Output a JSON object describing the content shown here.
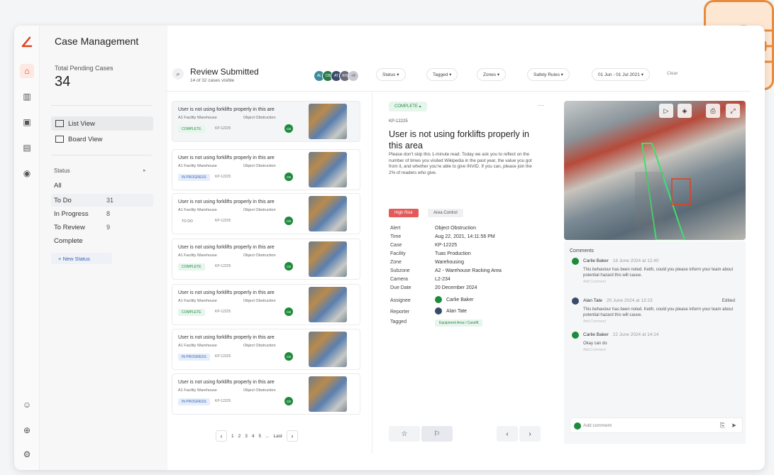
{
  "app": {
    "title": "Case Management"
  },
  "summary": {
    "label": "Total Pending Cases",
    "value": "34"
  },
  "views": [
    {
      "label": "List View"
    },
    {
      "label": "Board View"
    }
  ],
  "status": {
    "header": "Status",
    "items": [
      {
        "label": "All",
        "count": ""
      },
      {
        "label": "To Do",
        "count": "31"
      },
      {
        "label": "In Progress",
        "count": "8"
      },
      {
        "label": "To Review",
        "count": "9"
      },
      {
        "label": "Complete",
        "count": ""
      }
    ],
    "new_label": "+ New Status"
  },
  "review": {
    "title": "Review Submitted",
    "subtitle": "14 of 32 cases visible"
  },
  "filters": [
    {
      "label": "Status"
    },
    {
      "label": "Tagged"
    },
    {
      "label": "Zones"
    },
    {
      "label": "Safety Rules"
    },
    {
      "label": "01 Jun - 01 Jul 2021"
    }
  ],
  "clear_label": "Clear",
  "cases": [
    {
      "title": "User is not using forklifts properly in this are",
      "facility": "A1 Facility Warehouse",
      "type": "Object Obstruction",
      "status": "COMPLETE",
      "status_color": "#e6f6ec",
      "status_text_color": "#2a8a4a",
      "id": "KP-12225"
    },
    {
      "title": "User is not using forklifts properly in this are",
      "facility": "A1 Facility Warehouse",
      "type": "Object Obstruction",
      "status": "IN PROGRESS",
      "status_color": "#e6eefb",
      "status_text_color": "#3a64b8",
      "id": "KP-12225"
    },
    {
      "title": "User is not using forklifts properly in this are",
      "facility": "A1 Facility Warehouse",
      "type": "Object Obstruction",
      "status": "TO DO",
      "status_color": "#ffffff",
      "status_text_color": "#666666",
      "id": "KP-12225"
    },
    {
      "title": "User is not using forklifts properly in this are",
      "facility": "A1 Facility Warehouse",
      "type": "Object Obstruction",
      "status": "COMPLETE",
      "status_color": "#e6f6ec",
      "status_text_color": "#2a8a4a",
      "id": "KP-12225"
    },
    {
      "title": "User is not using forklifts properly in this are",
      "facility": "A1 Facility Warehouse",
      "type": "Object Obstruction",
      "status": "COMPLETE",
      "status_color": "#e6f6ec",
      "status_text_color": "#2a8a4a",
      "id": "KP-12225"
    },
    {
      "title": "User is not using forklifts properly in this are",
      "facility": "A1 Facility Warehouse",
      "type": "Object Obstruction",
      "status": "IN PROGRESS",
      "status_color": "#e6eefb",
      "status_text_color": "#3a64b8",
      "id": "KP-12225"
    },
    {
      "title": "User is not using forklifts properly in this are",
      "facility": "A1 Facility Warehouse",
      "type": "Object Obstruction",
      "status": "IN PROGRESS",
      "status_color": "#e6eefb",
      "status_text_color": "#3a64b8",
      "id": "KP-12225"
    }
  ],
  "pager": {
    "pages": [
      "1",
      "2",
      "3",
      "4",
      "5",
      "...",
      "Last"
    ]
  },
  "detail": {
    "status": "COMPLETE",
    "id": "KP-12225",
    "title": "User is not using forklifts properly in this area",
    "description": "Please don't skip this 1-minute read. Today we ask you to reflect on the number of times you visited Wikipedia in the past year, the value you got from it, and whether you're able to give INVID. If you can, please join the 2% of readers who give.",
    "tags": [
      "High Risk",
      "Area Control"
    ],
    "fields": [
      {
        "label": "Alert",
        "value": "Object Obstruction"
      },
      {
        "label": "Time",
        "value": "Aug 22, 2021, 14:11:56 PM"
      },
      {
        "label": "Case",
        "value": "KP-12225"
      },
      {
        "label": "Facility",
        "value": "Tuas Production"
      },
      {
        "label": "Zone",
        "value": "Warehousing"
      },
      {
        "label": "Subzone",
        "value": "A2 - Warehouse Racking Area"
      },
      {
        "label": "Camera",
        "value": "L2-234"
      },
      {
        "label": "Due Date",
        "value": "20 December 2024"
      },
      {
        "label": "Assignee",
        "value": "Carlie Baker"
      },
      {
        "label": "Reporter",
        "value": "Alan Tate"
      },
      {
        "label": "Tagged",
        "value": "Equipment Area / Caseflt"
      }
    ]
  },
  "comments": {
    "header": "Comments",
    "items": [
      {
        "name": "Carlie Baker",
        "date": "18 June 2024 at 12:40",
        "body": "This behaviour has been noted. Keith, could you please inform your team about potential hazard this will cause.",
        "action": "Add Comment",
        "avatar_color": "#1e8a3c"
      },
      {
        "name": "Alan Tate",
        "date": "20 June 2024 at 13:23",
        "body": "This behaviour has been noted. Keith, could you please inform your team about potential hazard this will cause.",
        "action": "Add Comment",
        "avatar_color": "#3a4a6a",
        "edited": "Edited"
      },
      {
        "name": "Carlie Baker",
        "date": "22 June 2024 at 14:14",
        "body": "Okay can do",
        "action": "Add Comment",
        "avatar_color": "#1e8a3c"
      }
    ],
    "placeholder": "Add comment"
  },
  "colors": {
    "accent": "#e2401c",
    "green": "#1e8a3c",
    "orange": "#e88a3c"
  }
}
